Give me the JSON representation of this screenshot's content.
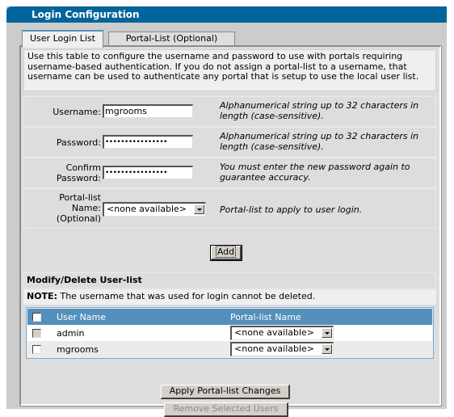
{
  "window": {
    "title": "Login Configuration"
  },
  "tabs": [
    {
      "label": "User Login List",
      "active": true
    },
    {
      "label": "Portal-List (Optional)",
      "active": false
    }
  ],
  "intro": "Use this table to configure the username and password to use with portals requiring username-based authentication. If you do not assign a portal-list to a username, that username can be used to authenticate any portal that is setup to use the local user list.",
  "form": {
    "username": {
      "label": "Username:",
      "value": "mgrooms",
      "hint": "Alphanumerical string up to 32 characters in length (case-sensitive)."
    },
    "password": {
      "label": "Password:",
      "value": "••••••••••••••••",
      "hint": "Alphanumerical string up to 32 characters in length (case-sensitive)."
    },
    "confirm": {
      "label_line1": "Confirm",
      "label_line2": "Password:",
      "value": "••••••••••••••••",
      "hint": "You must enter the new password again to guarantee accuracy."
    },
    "portal": {
      "label_line1": "Portal-list",
      "label_line2": "Name:",
      "label_line3": "(Optional)",
      "selected": "<none available>",
      "hint": "Portal-list to apply to user login."
    },
    "add_label": "Add"
  },
  "modify": {
    "title": "Modify/Delete User-list",
    "note_bold": "NOTE:",
    "note_text": " The username that was used for login cannot be deleted.",
    "columns": [
      "User Name",
      "Portal-list Name"
    ],
    "rows": [
      {
        "user": "admin",
        "portal": "<none available>",
        "checkbox_disabled": true
      },
      {
        "user": "mgrooms",
        "portal": "<none available>",
        "checkbox_disabled": false
      }
    ],
    "apply_label": "Apply Portal-list Changes",
    "remove_label": "Remove Selected Users"
  }
}
